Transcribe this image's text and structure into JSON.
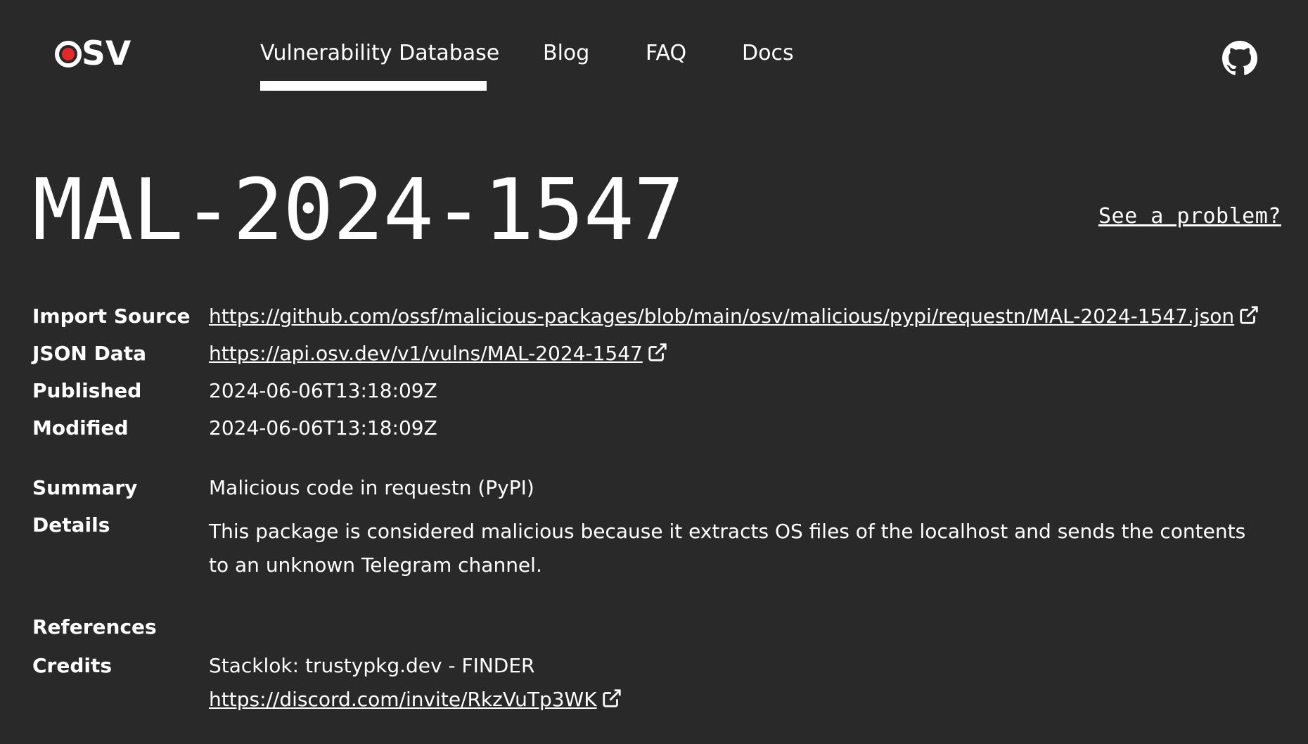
{
  "header": {
    "logo_text": "SV",
    "nav": [
      {
        "label": "Vulnerability Database",
        "active": true
      },
      {
        "label": "Blog",
        "active": false
      },
      {
        "label": "FAQ",
        "active": false
      },
      {
        "label": "Docs",
        "active": false
      }
    ],
    "github_icon": "github-icon"
  },
  "vuln": {
    "id": "MAL-2024-1547",
    "problem_link": "See a problem?"
  },
  "fields": {
    "import_source": {
      "label": "Import Source",
      "url": "https://github.com/ossf/malicious-packages/blob/main/osv/malicious/pypi/requestn/MAL-2024-1547.json"
    },
    "json_data": {
      "label": "JSON Data",
      "url": "https://api.osv.dev/v1/vulns/MAL-2024-1547"
    },
    "published": {
      "label": "Published",
      "value": "2024-06-06T13:18:09Z"
    },
    "modified": {
      "label": "Modified",
      "value": "2024-06-06T13:18:09Z"
    },
    "summary": {
      "label": "Summary",
      "value": "Malicious code in requestn (PyPI)"
    },
    "details": {
      "label": "Details",
      "value": "This package is considered malicious because it extracts OS files of the localhost and sends the contents to an unknown Telegram channel."
    },
    "references": {
      "label": "References"
    },
    "credits": {
      "label": "Credits",
      "value": "Stacklok: trustypkg.dev - FINDER",
      "url": "https://discord.com/invite/RkzVuTp3WK"
    }
  },
  "colors": {
    "background": "#292929",
    "text": "#ffffff",
    "logo_accent": "#e52829"
  },
  "icons": {
    "external_link": "external-link-icon"
  }
}
